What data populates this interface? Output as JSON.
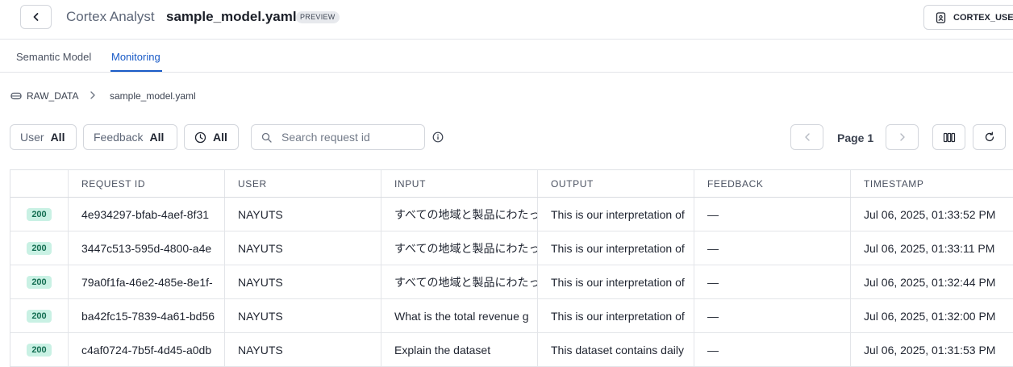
{
  "header": {
    "app_title": "Cortex Analyst",
    "file_title": "sample_model.yaml",
    "badge": "PREVIEW",
    "user_role": "CORTEX_USER"
  },
  "tabs": [
    {
      "label": "Semantic Model",
      "active": false
    },
    {
      "label": "Monitoring",
      "active": true
    }
  ],
  "breadcrumb": {
    "database": "RAW_DATA",
    "file": "sample_model.yaml"
  },
  "toolbar": {
    "user_filter_label": "User",
    "user_filter_value": "All",
    "feedback_filter_label": "Feedback",
    "feedback_filter_value": "All",
    "time_filter_value": "All",
    "search_placeholder": "Search request id",
    "page_label": "Page 1"
  },
  "table": {
    "columns": [
      "",
      "REQUEST ID",
      "USER",
      "INPUT",
      "OUTPUT",
      "FEEDBACK",
      "TIMESTAMP"
    ],
    "rows": [
      {
        "status": "200",
        "request_id": "4e934297-bfab-4aef-8f31",
        "user": "NAYUTS",
        "input": "すべての地域と製品にわたっ",
        "output": "This is our interpretation of",
        "feedback": "—",
        "timestamp": "Jul 06, 2025, 01:33:52 PM"
      },
      {
        "status": "200",
        "request_id": "3447c513-595d-4800-a4e",
        "user": "NAYUTS",
        "input": "すべての地域と製品にわたっ",
        "output": "This is our interpretation of",
        "feedback": "—",
        "timestamp": "Jul 06, 2025, 01:33:11 PM"
      },
      {
        "status": "200",
        "request_id": "79a0f1fa-46e2-485e-8e1f-",
        "user": "NAYUTS",
        "input": "すべての地域と製品にわたっ",
        "output": "This is our interpretation of",
        "feedback": "—",
        "timestamp": "Jul 06, 2025, 01:32:44 PM"
      },
      {
        "status": "200",
        "request_id": "ba42fc15-7839-4a61-bd56",
        "user": "NAYUTS",
        "input": "What is the total revenue g",
        "output": "This is our interpretation of",
        "feedback": "—",
        "timestamp": "Jul 06, 2025, 01:32:00 PM"
      },
      {
        "status": "200",
        "request_id": "c4af0724-7b5f-4d45-a0db",
        "user": "NAYUTS",
        "input": "Explain the dataset",
        "output": "This dataset contains daily",
        "feedback": "—",
        "timestamp": "Jul 06, 2025, 01:31:53 PM"
      }
    ]
  },
  "icons": {
    "back": "chevron-left-icon",
    "user_role": "id-badge-icon",
    "database": "database-icon",
    "separator": "chevron-right-icon",
    "clock": "clock-icon",
    "search": "search-icon",
    "info": "info-icon",
    "columns": "columns-icon",
    "refresh": "refresh-icon"
  },
  "colors": {
    "accent": "#1a5bc7",
    "status_bg": "#c9f1e4",
    "status_text": "#146e52"
  }
}
